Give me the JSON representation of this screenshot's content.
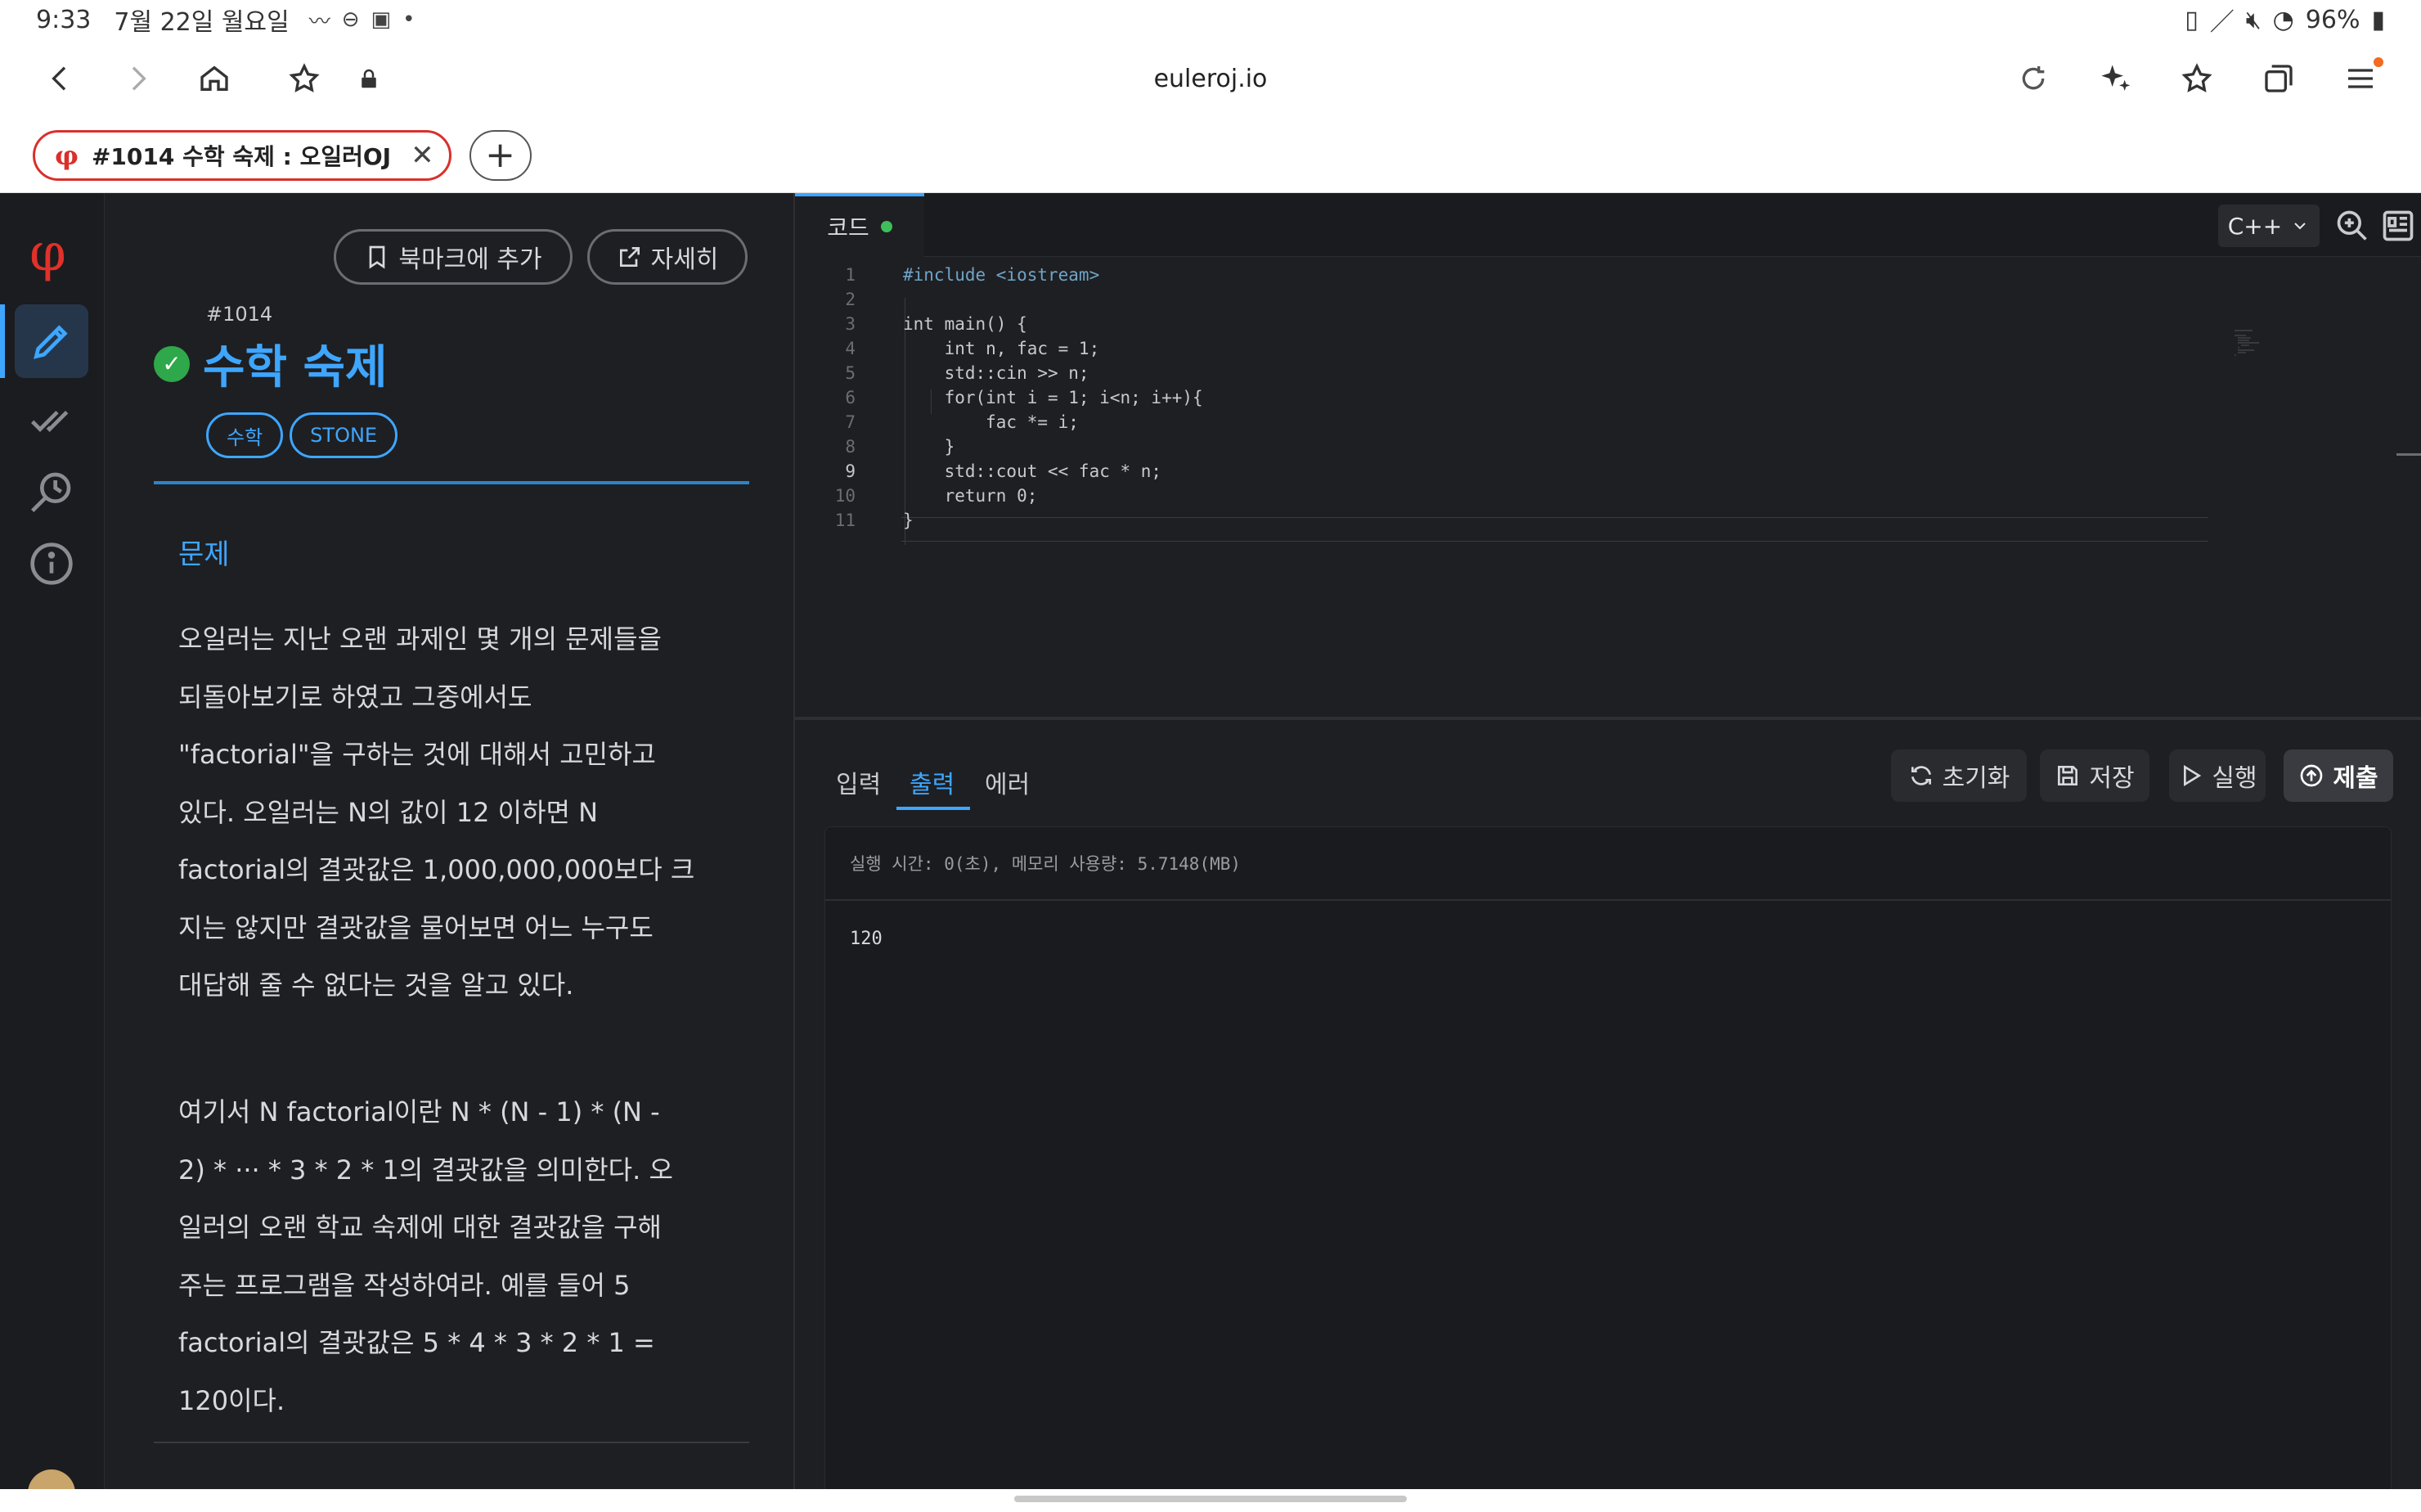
{
  "status": {
    "time": "9:33",
    "date": "7월 22일 월요일",
    "battery": "96%"
  },
  "browser": {
    "url": "euleroj.io",
    "tab_title": "#1014 수학 숙제 : 오일러OJ",
    "tab_favicon": "φ",
    "new_tab": "+",
    "close": "✕"
  },
  "rail": {
    "logo": "φ"
  },
  "problem": {
    "bookmark_label": "북마크에 추가",
    "detail_label": "자세히",
    "number": "#1014",
    "title": "수학 숙제",
    "tags": [
      "수학",
      "STONE"
    ],
    "section_title": "문제",
    "paragraph1_lines": [
      "오일러는 지난 오랜 과제인 몇 개의 문제들을",
      "되돌아보기로 하였고 그중에서도",
      "\"factorial\"을 구하는 것에 대해서 고민하고",
      "있다. 오일러는 N의 값이 12 이하면 N",
      "factorial의 결괏값은 1,000,000,000보다 크",
      "지는 않지만 결괏값을 물어보면 어느 누구도",
      "대답해 줄 수 없다는 것을 알고 있다."
    ],
    "paragraph2_lines": [
      "여기서 N factorial이란 N * (N - 1) * (N -",
      "2) * ··· * 3 * 2 * 1의 결괏값을 의미한다. 오",
      "일러의 오랜 학교 숙제에 대한 결괏값을 구해",
      "주는 프로그램을 작성하여라. 예를 들어 5",
      "factorial의 결괏값은 5 * 4 * 3 * 2 * 1 =",
      "120이다."
    ]
  },
  "editor": {
    "tab_label": "코드",
    "language": "C++",
    "lines": [
      "#include <iostream>",
      "",
      "int main() {",
      "    int n, fac = 1;",
      "    std::cin >> n;",
      "    for(int i = 1; i<n; i++){",
      "        fac *= i;",
      "    }",
      "    std::cout << fac * n;",
      "    return 0;",
      "}"
    ]
  },
  "output": {
    "tabs": [
      "입력",
      "출력",
      "에러"
    ],
    "active_tab": "출력",
    "reset_label": "초기화",
    "save_label": "저장",
    "run_label": "실행",
    "submit_label": "제출",
    "result_info": "실행 시간: 0(초), 메모리 사용량: 5.7148(MB)",
    "result_value": "120"
  },
  "colors": {
    "accent": "#3ea6ff",
    "brand": "#e0312a",
    "success": "#2ea84a"
  }
}
